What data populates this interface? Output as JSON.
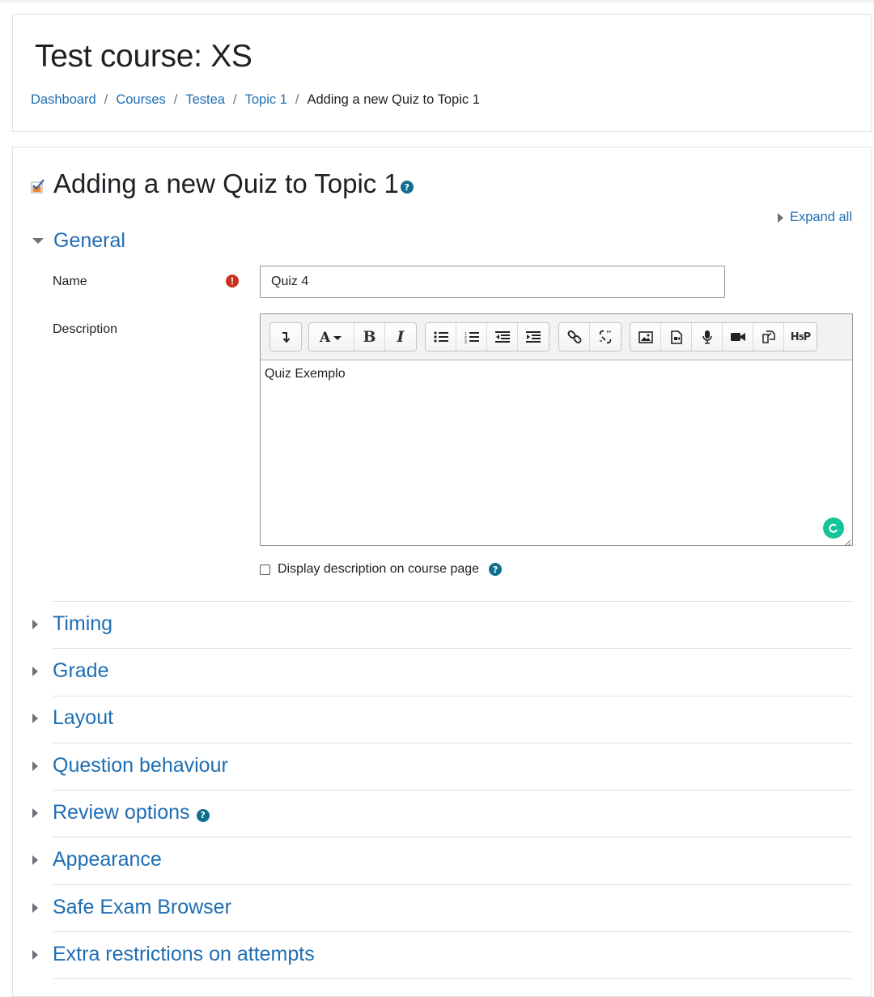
{
  "header": {
    "course_title": "Test course: XS",
    "breadcrumb": [
      {
        "label": "Dashboard"
      },
      {
        "label": "Courses"
      },
      {
        "label": "Testea"
      },
      {
        "label": "Topic 1"
      }
    ],
    "breadcrumb_current": "Adding a new Quiz to Topic 1",
    "separator": "/"
  },
  "form": {
    "heading": "Adding a new Quiz to Topic 1",
    "expand_all": "Expand all",
    "general": {
      "title": "General",
      "name_label": "Name",
      "name_value": "Quiz 4",
      "description_label": "Description",
      "description_text": "Quiz Exemplo",
      "display_description_label": "Display description on course page",
      "display_description_checked": false
    },
    "sections": [
      {
        "title": "Timing"
      },
      {
        "title": "Grade"
      },
      {
        "title": "Layout"
      },
      {
        "title": "Question behaviour"
      },
      {
        "title": "Review options"
      },
      {
        "title": "Appearance"
      },
      {
        "title": "Safe Exam Browser"
      },
      {
        "title": "Extra restrictions on attempts"
      }
    ]
  },
  "toolbar": {
    "icons": [
      "show-more-icon",
      "font-color-icon",
      "bold-icon",
      "italic-icon",
      "unordered-list-icon",
      "ordered-list-icon",
      "outdent-icon",
      "indent-icon",
      "link-icon",
      "unlink-icon",
      "image-icon",
      "media-icon",
      "record-audio-icon",
      "record-video-icon",
      "manage-files-icon",
      "h5p-icon"
    ]
  },
  "colors": {
    "link": "#1f6db3",
    "required": "#ca3120",
    "help": "#0f6f8c",
    "grammarly": "#15c39a"
  }
}
